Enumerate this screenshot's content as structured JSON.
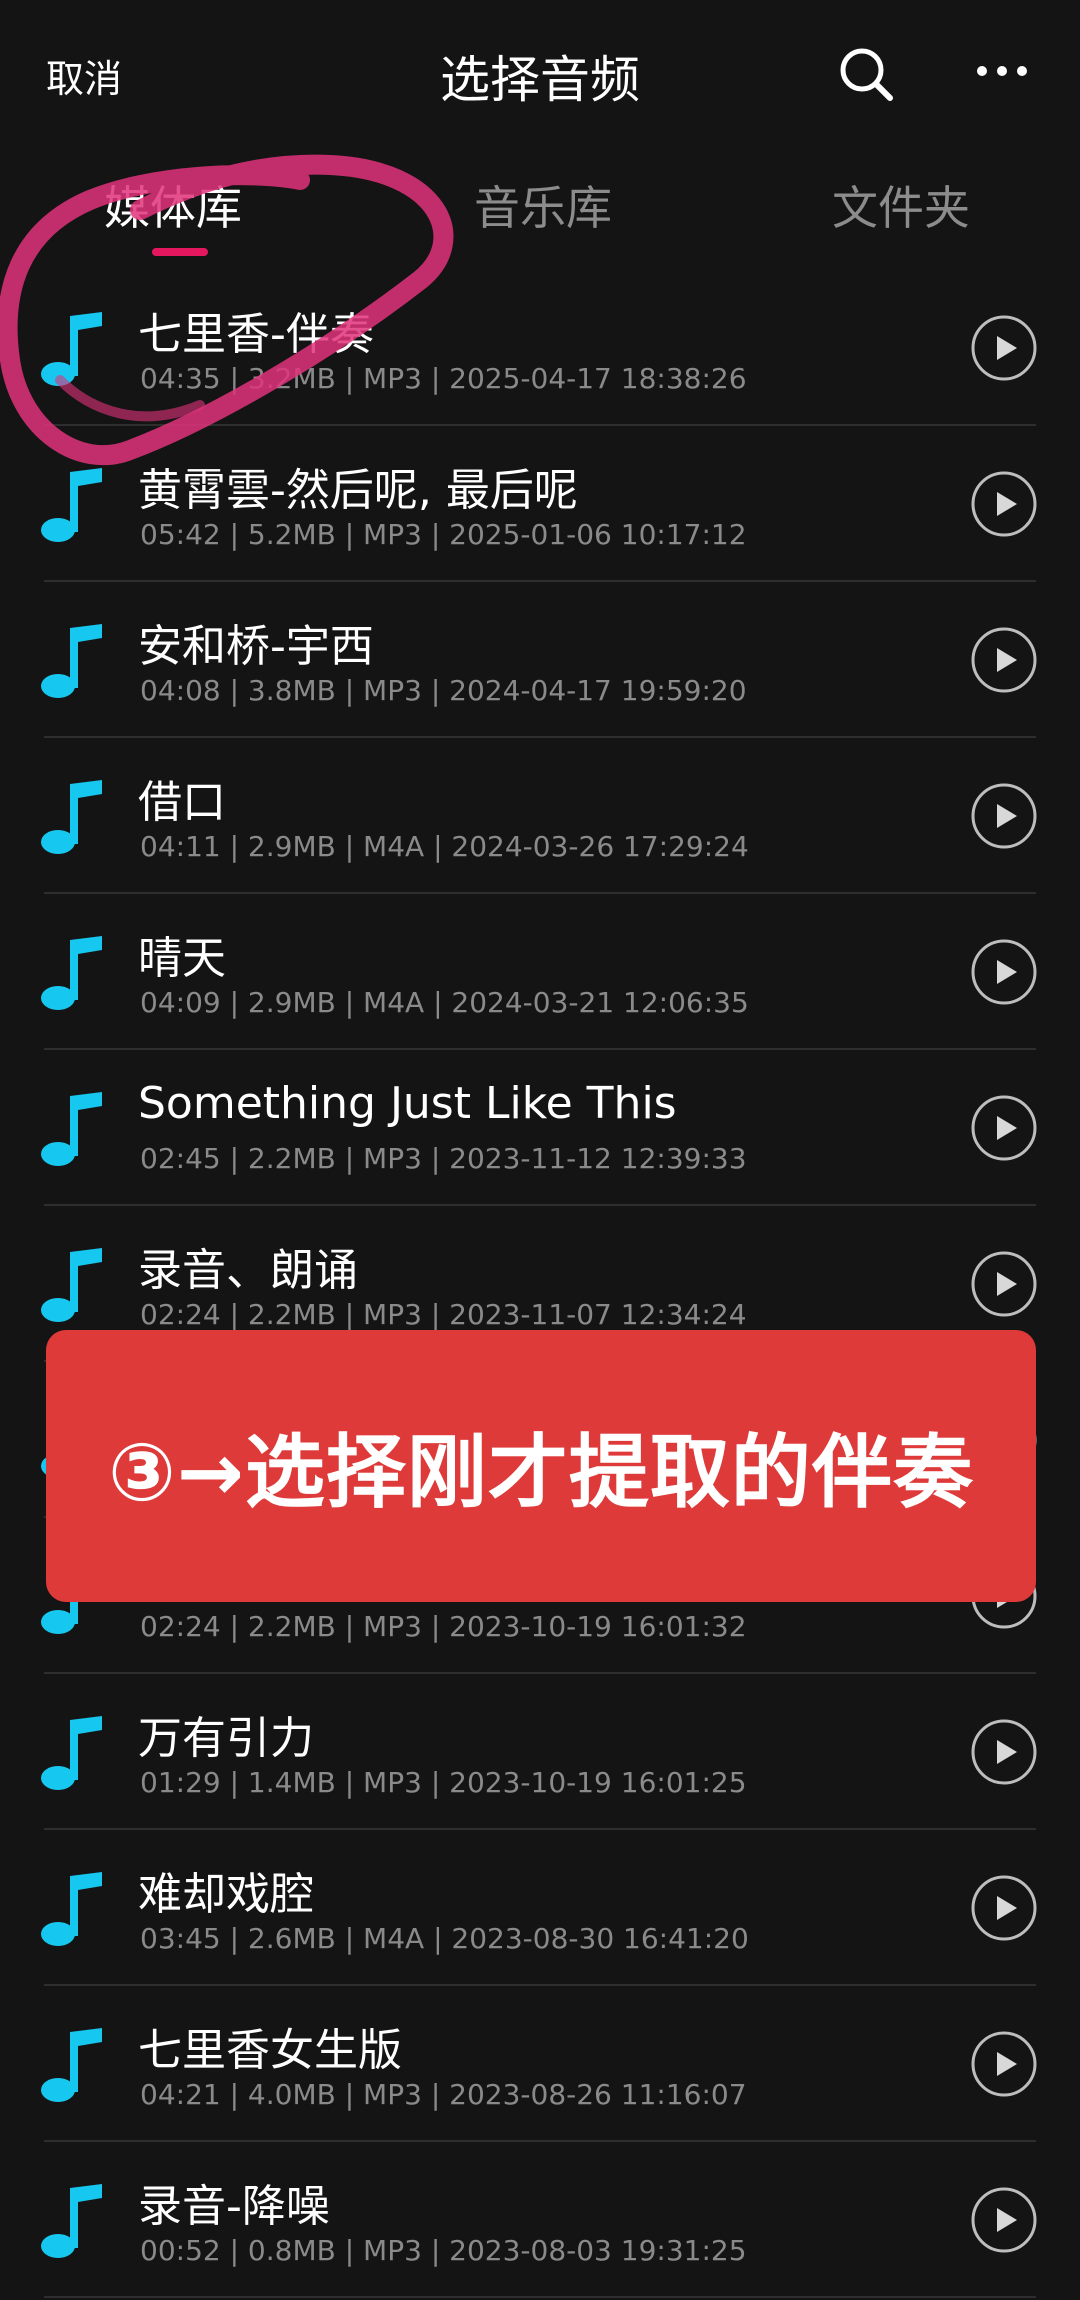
{
  "header": {
    "cancel_label": "取消",
    "title": "选择音频",
    "search_icon": "search-icon",
    "more_icon": "more-horizontal-icon"
  },
  "tabs": [
    {
      "label": "媒体库",
      "active": true
    },
    {
      "label": "音乐库",
      "active": false
    },
    {
      "label": "文件夹",
      "active": false
    }
  ],
  "colors": {
    "background": "#141414",
    "accent": "#e5175f",
    "note_icon": "#16c8f0",
    "meta_text": "#8a8a8a",
    "banner": "#df3a3a",
    "annotation": "#e0327a"
  },
  "songs": [
    {
      "title": "七里香-伴奏",
      "meta": "04:35 | 3.2MB | MP3 | 2025-04-17 18:38:26"
    },
    {
      "title": "黄霄雲-然后呢, 最后呢",
      "meta": "05:42 | 5.2MB | MP3 | 2025-01-06 10:17:12"
    },
    {
      "title": "安和桥-宇西",
      "meta": "04:08 | 3.8MB | MP3 | 2024-04-17 19:59:20"
    },
    {
      "title": "借口",
      "meta": "04:11 | 2.9MB | M4A | 2024-03-26 17:29:24"
    },
    {
      "title": "晴天",
      "meta": "04:09 | 2.9MB | M4A | 2024-03-21 12:06:35"
    },
    {
      "title": "Something Just Like This",
      "meta": "02:45 | 2.2MB | MP3 | 2023-11-12 12:39:33"
    },
    {
      "title": "录音、朗诵",
      "meta": "02:24 | 2.2MB | MP3 | 2023-11-07 12:34:24"
    },
    {
      "title": "",
      "meta": ""
    },
    {
      "title": "",
      "meta": "02:24 | 2.2MB | MP3 | 2023-10-19 16:01:32"
    },
    {
      "title": "万有引力",
      "meta": "01:29 | 1.4MB | MP3 | 2023-10-19 16:01:25"
    },
    {
      "title": "难却戏腔",
      "meta": "03:45 | 2.6MB | M4A | 2023-08-30 16:41:20"
    },
    {
      "title": "七里香女生版",
      "meta": "04:21 | 4.0MB | MP3 | 2023-08-26 11:16:07"
    },
    {
      "title": "录音-降噪",
      "meta": "00:52 | 0.8MB | MP3 | 2023-08-03 19:31:25"
    }
  ],
  "banner": {
    "text": "③→选择刚才提取的伴奏"
  }
}
